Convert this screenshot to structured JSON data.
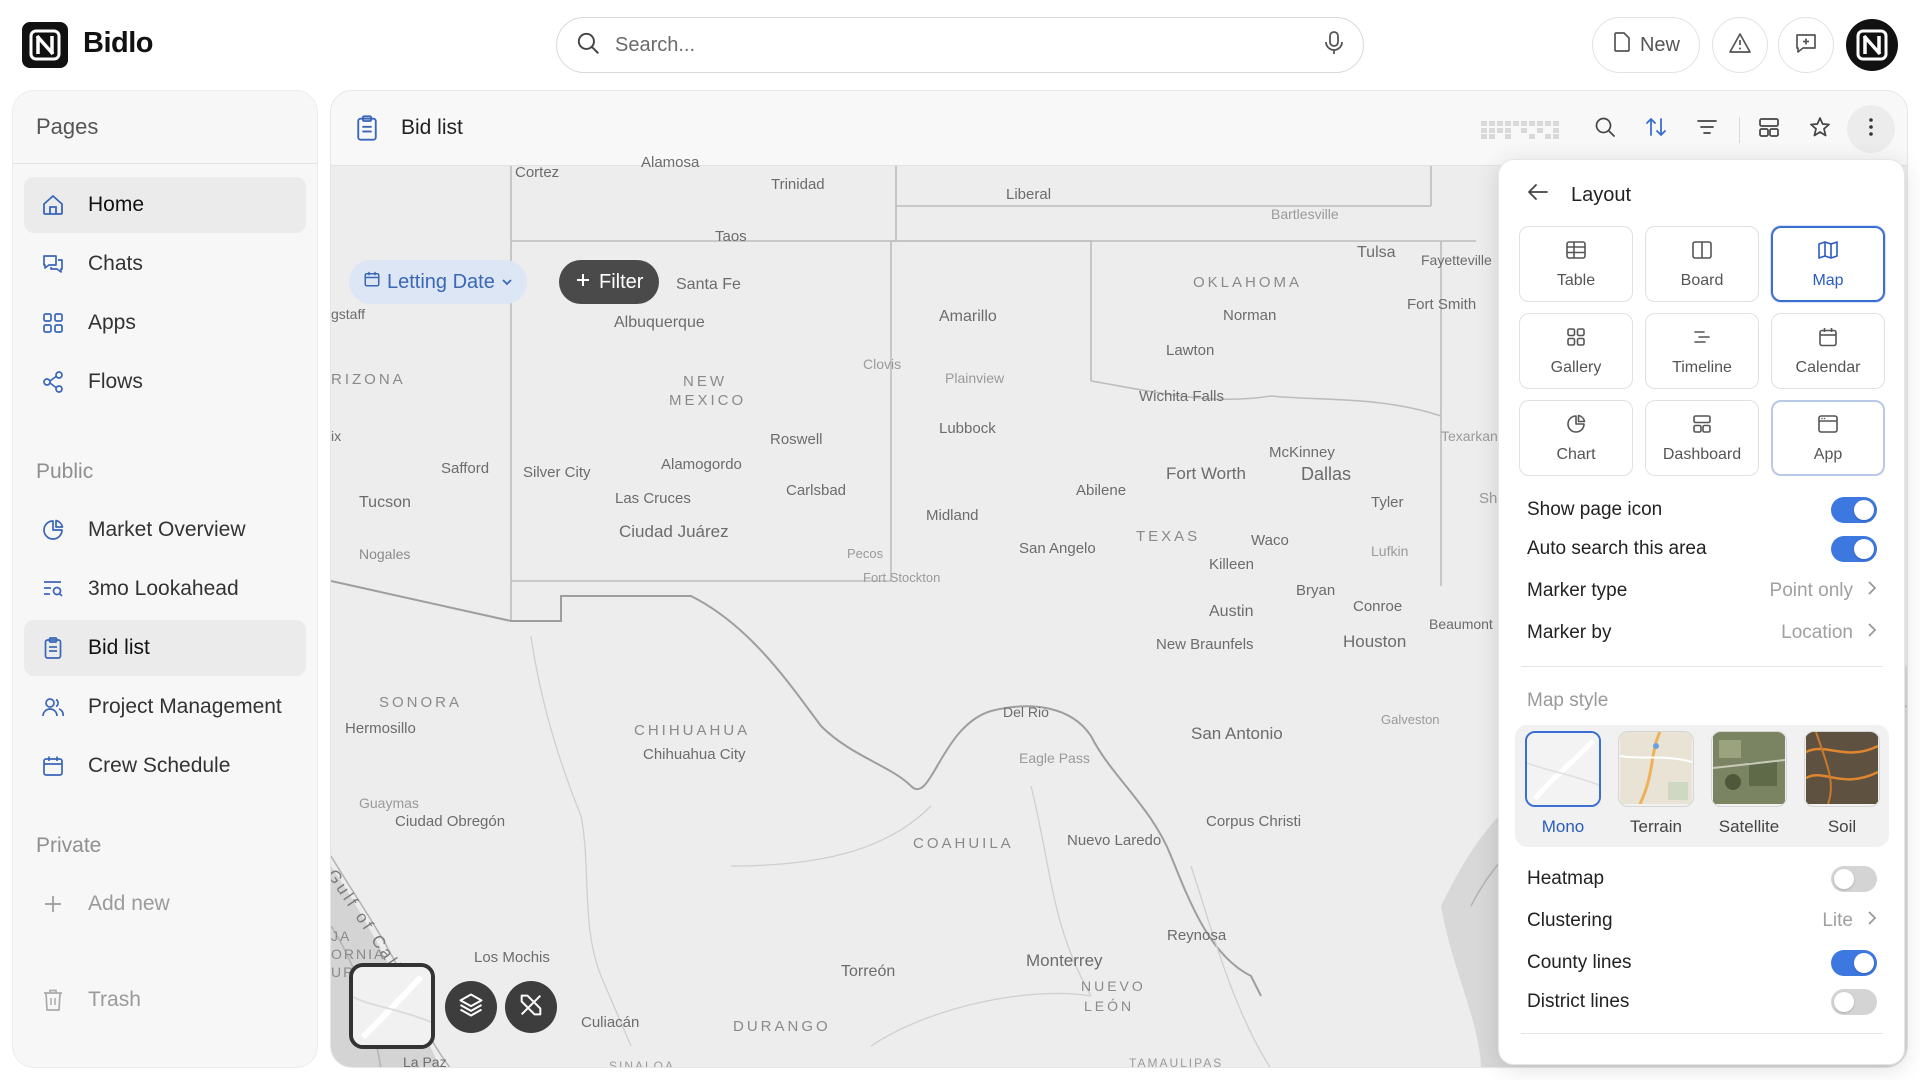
{
  "app": {
    "name": "Bidlo"
  },
  "search": {
    "placeholder": "Search..."
  },
  "topbar": {
    "new_label": "New"
  },
  "sidebar": {
    "title": "Pages",
    "items": [
      {
        "label": "Home",
        "icon": "home-icon"
      },
      {
        "label": "Chats",
        "icon": "chat-icon"
      },
      {
        "label": "Apps",
        "icon": "apps-icon"
      },
      {
        "label": "Flows",
        "icon": "flows-icon"
      }
    ],
    "public_label": "Public",
    "public_items": [
      {
        "label": "Market Overview",
        "icon": "pie-chart-icon"
      },
      {
        "label": "3mo Lookahead",
        "icon": "list-search-icon"
      },
      {
        "label": "Bid list",
        "icon": "clipboard-icon"
      },
      {
        "label": "Project Management",
        "icon": "users-icon"
      },
      {
        "label": "Crew Schedule",
        "icon": "calendar-icon"
      }
    ],
    "private_label": "Private",
    "add_new_label": "Add new",
    "trash_label": "Trash"
  },
  "main": {
    "title": "Bid list",
    "filters": {
      "date_chip": "Letting Date",
      "filter_label": "Filter"
    }
  },
  "map_labels": [
    "Cortez",
    "Alamosa",
    "Trinidad",
    "Liberal",
    "Bartlesville",
    "Tulsa",
    "Fayetteville",
    "Taos",
    "Santa Fe",
    "OKLAHOMA",
    "Fort Smith",
    "gstaff",
    "Albuquerque",
    "Amarillo",
    "Norman",
    "Lawton",
    "RIZONA",
    "NEW",
    "MEXICO",
    "Clovis",
    "Plainview",
    "Wichita Falls",
    "Lubbock",
    "Roswell",
    "McKinney",
    "Texarkana",
    "ix",
    "Safford",
    "Silver City",
    "Alamogordo",
    "Fort Worth",
    "Dallas",
    "Shreve",
    "Abilene",
    "Tyler",
    "Tucson",
    "Las Cruces",
    "Carlsbad",
    "Midland",
    "Ciudad Juárez",
    "TEXAS",
    "Waco",
    "Lufkin",
    "Nogales",
    "Pecos",
    "San Angelo",
    "Killeen",
    "Fort Stockton",
    "Bryan",
    "Conroe",
    "Austin",
    "Beaumont",
    "SONORA",
    "New Braunfels",
    "Houston",
    "Hermosillo",
    "CHIHUAHUA",
    "Del Rio",
    "Galveston",
    "San Antonio",
    "Chihuahua City",
    "Eagle Pass",
    "Guaymas",
    "Ciudad Obregón",
    "COAHUILA",
    "Nuevo Laredo",
    "Corpus Christi",
    "Gulf of California",
    "JA",
    "ORNIA",
    "UR",
    "Los Mochis",
    "Reynosa",
    "Monterrey",
    "Torreón",
    "NUEVO",
    "LEÓN",
    "Culiacán",
    "DURANGO",
    "La Paz",
    "SINALOA",
    "TAMAULIPAS"
  ],
  "layout_panel": {
    "title": "Layout",
    "views": [
      {
        "label": "Table",
        "icon": "table-icon"
      },
      {
        "label": "Board",
        "icon": "board-icon"
      },
      {
        "label": "Map",
        "icon": "map-icon"
      },
      {
        "label": "Gallery",
        "icon": "gallery-icon"
      },
      {
        "label": "Timeline",
        "icon": "timeline-icon"
      },
      {
        "label": "Calendar",
        "icon": "calendar-icon"
      },
      {
        "label": "Chart",
        "icon": "chart-icon"
      },
      {
        "label": "Dashboard",
        "icon": "dashboard-icon"
      },
      {
        "label": "App",
        "icon": "app-window-icon"
      }
    ],
    "selected_view": "Map",
    "show_page_icon": {
      "label": "Show page icon",
      "on": true
    },
    "auto_search": {
      "label": "Auto search this area",
      "on": true
    },
    "marker_type": {
      "label": "Marker type",
      "value": "Point only"
    },
    "marker_by": {
      "label": "Marker by",
      "value": "Location"
    },
    "map_style_label": "Map style",
    "map_styles": [
      {
        "label": "Mono"
      },
      {
        "label": "Terrain"
      },
      {
        "label": "Satellite"
      },
      {
        "label": "Soil"
      }
    ],
    "selected_style": "Mono",
    "heatmap": {
      "label": "Heatmap",
      "on": false
    },
    "clustering": {
      "label": "Clustering",
      "value": "Lite"
    },
    "county_lines": {
      "label": "County lines",
      "on": true
    },
    "district_lines": {
      "label": "District lines",
      "on": false
    }
  },
  "colors": {
    "accent": "#3d78e0",
    "selected_border": "#3a6fd1",
    "chip_bg": "#dde6f4",
    "chip_text": "#3a67b7",
    "map_bg": "#eeeeee"
  }
}
